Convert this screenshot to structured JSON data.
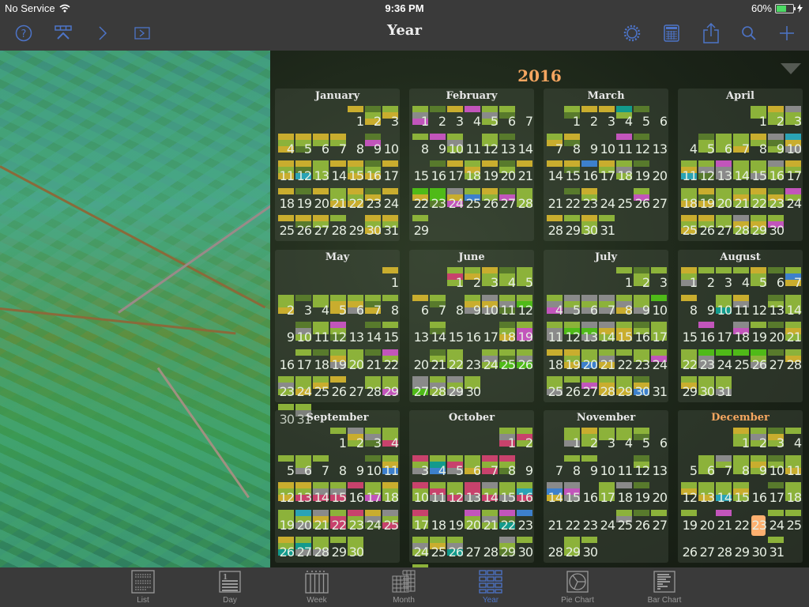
{
  "status": {
    "carrier": "No Service",
    "time": "9:36 PM",
    "battery": "60%",
    "battery_level": 0.6
  },
  "nav": {
    "title": "Year",
    "left_buttons": [
      "help-icon",
      "filter-icon",
      "chevron-right-icon",
      "forward-box-icon"
    ],
    "right_buttons": [
      "gear-icon",
      "calendar-grid-icon",
      "share-icon",
      "search-icon",
      "add-icon"
    ]
  },
  "calendar": {
    "year": "2016",
    "today": {
      "month": 11,
      "day": 23
    },
    "colors": {
      "Y": "#c9ad2e",
      "G": "#8cb23a",
      "D": "#587a2c",
      "P": "#c255bb",
      "K": "#8a8a8a",
      "T": "#139a8c",
      "B": "#3d80cc",
      "R": "#c8426c",
      "L": "#4fba18",
      "C": "#2aa3b5"
    },
    "months": [
      {
        "name": "January",
        "offset": 4,
        "days": 31,
        "marks": {
          "1": "Y",
          "2": "DGY",
          "3": "GY",
          "4": "YGY",
          "5": "YGD",
          "6": "YG",
          "7": "YG",
          "9": "DP",
          "11": "YGY",
          "12": "YDC",
          "13": "GGG",
          "14": "Y",
          "15": "YGY",
          "16": "DGY",
          "17": "Y",
          "18": "Y",
          "19": "D",
          "20": "Y",
          "21": "GGY",
          "22": "YGY",
          "23": "DY",
          "24": "Y",
          "25": "Y",
          "26": "YD",
          "27": "YG",
          "28": "G",
          "30": "YGY",
          "31": "YG"
        }
      },
      {
        "name": "February",
        "offset": 0,
        "days": 29,
        "marks": {
          "1": "GKP",
          "2": "D",
          "3": "Y",
          "4": "P",
          "5": "GKG",
          "6": "GD",
          "8": "G",
          "9": "P",
          "10": "GKG",
          "12": "GG",
          "13": "D",
          "16": "D",
          "17": "Y",
          "18": "GYG",
          "19": "Y",
          "20": "DG",
          "21": "Y",
          "22": "LY",
          "23": "LLD",
          "24": "KYP",
          "25": "GB",
          "26": "YG",
          "27": "DP",
          "28": "GGG",
          "29": "G"
        }
      },
      {
        "name": "March",
        "offset": 1,
        "days": 31,
        "marks": {
          "1": "GD",
          "2": "Y",
          "3": "Y",
          "4": "TG",
          "5": "D",
          "7": "GY",
          "8": "YD",
          "11": "P",
          "12": "D",
          "14": "Y",
          "15": "YD",
          "16": "B",
          "17": "YG",
          "18": "GKG",
          "19": "D",
          "22": "D",
          "23": "YG",
          "26": "GP",
          "28": "Y",
          "29": "G",
          "30": "YGG",
          "31": "G"
        }
      },
      {
        "name": "April",
        "offset": 4,
        "days": 30,
        "marks": {
          "1": "GG",
          "2": "YGG",
          "3": "KGG",
          "5": "DGG",
          "6": "GGG",
          "7": "GGY",
          "8": "YG",
          "9": "KDG",
          "10": "CYK",
          "11": "GYC",
          "12": "GKD",
          "13": "PKK",
          "14": "GGG",
          "15": "GGK",
          "16": "KGG",
          "17": "YG",
          "18": "GGY",
          "19": "YDY",
          "20": "GGG",
          "21": "GYG",
          "22": "YGG",
          "23": "DYG",
          "24": "PG",
          "25": "YGY",
          "26": "YG",
          "27": "GG",
          "28": "KYG",
          "29": "GYG",
          "30": "GP"
        }
      },
      {
        "name": "May",
        "offset": 6,
        "days": 31,
        "marks": {
          "1": "Y",
          "2": "GGY",
          "3": "D",
          "4": "GG",
          "5": "GYY",
          "6": "GYK",
          "7": "GDY",
          "8": "G",
          "10": "DKG",
          "11": "GG",
          "12": "PGD",
          "14": "D",
          "15": "G",
          "17": "G",
          "18": "D",
          "19": "GYK",
          "20": "GGG",
          "21": "D",
          "22": "PG",
          "23": "GKG",
          "24": "GGY",
          "25": "GY",
          "26": "Y",
          "28": "GG",
          "29": "GGP",
          "30": "G",
          "31": "GK"
        }
      },
      {
        "name": "June",
        "offset": 2,
        "days": 30,
        "marks": {
          "1": "GRG",
          "2": "GY",
          "3": "YGG",
          "4": "DGG",
          "5": "GGG",
          "6": "Y",
          "7": "GD",
          "9": "GYK",
          "10": "KYK",
          "11": "GKD",
          "12": "GL",
          "14": "GD",
          "18": "DGY",
          "19": "GPP",
          "21": "DG",
          "22": "GGG",
          "24": "GKG",
          "25": "GDL",
          "26": "GKL",
          "27": "KKL",
          "28": "GKG",
          "29": "KGK",
          "30": "GG"
        }
      },
      {
        "name": "July",
        "offset": 4,
        "days": 31,
        "marks": {
          "1": "G",
          "2": "DGG",
          "3": "G",
          "4": "GKP",
          "5": "KGK",
          "6": "KGK",
          "7": "KGK",
          "8": "GKY",
          "9": "GGK",
          "10": "L",
          "11": "GKK",
          "12": "GL",
          "13": "KLK",
          "14": "KYG",
          "15": "GYY",
          "16": "DG",
          "17": "GGG",
          "18": "Y",
          "19": "YGY",
          "20": "GGB",
          "21": "GKY",
          "22": "G",
          "23": "GG",
          "24": "GP",
          "25": "GGK",
          "26": "G",
          "27": "GP",
          "28": "GYY",
          "29": "GGY",
          "30": "DYB"
        }
      },
      {
        "name": "August",
        "offset": 0,
        "days": 31,
        "marks": {
          "1": "YGK",
          "2": "G",
          "3": "G",
          "4": "G",
          "5": "YGG",
          "6": "D",
          "7": "GBY",
          "8": "Y",
          "10": "GGT",
          "11": "YK",
          "13": "DG",
          "14": "GGG",
          "16": "P",
          "18": "KP",
          "19": "G",
          "20": "D",
          "21": "GYG",
          "22": "GGG",
          "23": "LKK",
          "24": "L",
          "25": "L",
          "26": "LGK",
          "27": "D",
          "28": "GY",
          "29": "GY",
          "30": "GGG",
          "31": "GGK"
        }
      },
      {
        "name": "September",
        "offset": 3,
        "days": 30,
        "marks": {
          "1": "G",
          "2": "KYG",
          "3": "GKD",
          "4": "GGR",
          "5": "G",
          "6": "GGK",
          "7": "G",
          "10": "D",
          "11": "GYB",
          "12": "YGY",
          "13": "YGR",
          "14": "GKR",
          "15": "GKR",
          "16": "R",
          "17": "GGP",
          "18": "YGG",
          "19": "GGG",
          "20": "CGK",
          "21": "KYG",
          "22": "GRR",
          "23": "RGG",
          "24": "YKD",
          "25": "KGR",
          "26": "YGT",
          "27": "GTK",
          "28": "GGK",
          "29": "G",
          "30": "GGG"
        }
      },
      {
        "name": "October",
        "offset": 5,
        "days": 31,
        "marks": {
          "1": "GKR",
          "2": "GRG",
          "3": "RGK",
          "4": "GTB",
          "5": "GRK",
          "6": "GGY",
          "7": "RGR",
          "8": "RGD",
          "10": "RGG",
          "11": "GRK",
          "12": "GGR",
          "13": "RRK",
          "14": "KGR",
          "15": "GGK",
          "16": "GCR",
          "17": "RGG",
          "20": "PGG",
          "21": "GKG",
          "22": "PDT",
          "23": "B",
          "24": "GKG",
          "25": "GY",
          "26": "GKT",
          "29": "KGD",
          "30": "G",
          "31": "GKG"
        }
      },
      {
        "name": "November",
        "offset": 1,
        "days": 30,
        "marks": {
          "1": "GGK",
          "2": "YGG",
          "3": "GG",
          "4": "GG",
          "5": "GD",
          "8": "G",
          "9": "G",
          "12": "DG",
          "14": "KBY",
          "15": "KPK",
          "17": "GGG",
          "18": "K",
          "19": "D",
          "25": "GK",
          "26": "D",
          "27": "G",
          "29": "GGG",
          "30": "G"
        }
      },
      {
        "name": "December",
        "offset": 3,
        "days": 31,
        "marks": {
          "1": "YGG",
          "2": "GKG",
          "3": "DYG",
          "4": "G",
          "6": "GGG",
          "7": "KG",
          "8": "GGG",
          "9": "GYG",
          "10": "DG",
          "11": "GGY",
          "12": "GY",
          "13": "GGY",
          "14": "GGC",
          "15": "GYG",
          "17": "D",
          "18": "GGG",
          "19": "G",
          "21": "P",
          "24": "G",
          "25": "G",
          "31": "G"
        }
      }
    ]
  },
  "tabs": [
    {
      "label": "List",
      "icon": "list-icon"
    },
    {
      "label": "Day",
      "icon": "day-icon"
    },
    {
      "label": "Week",
      "icon": "week-icon"
    },
    {
      "label": "Month",
      "icon": "month-icon"
    },
    {
      "label": "Year",
      "icon": "year-icon",
      "active": true
    },
    {
      "label": "Pie Chart",
      "icon": "pie-chart-icon"
    },
    {
      "label": "Bar Chart",
      "icon": "bar-chart-icon"
    }
  ]
}
